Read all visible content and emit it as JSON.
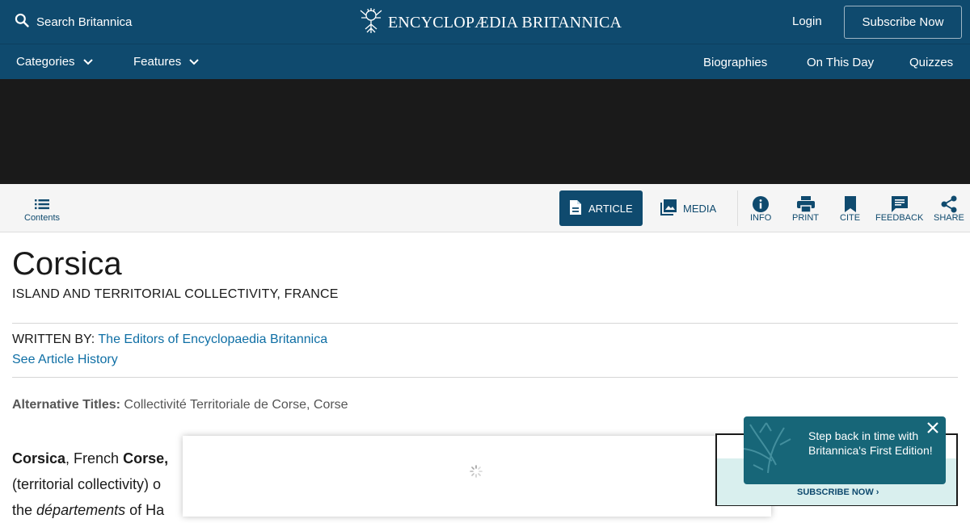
{
  "header": {
    "search_label": "Search Britannica",
    "logo_text": "ENCYCLOPÆDIA BRITANNICA",
    "login_label": "Login",
    "subscribe_label": "Subscribe Now"
  },
  "nav": {
    "left": [
      {
        "label": "Categories",
        "icon": "chevron-down-icon"
      },
      {
        "label": "Features",
        "icon": "chevron-down-icon"
      }
    ],
    "right": [
      "Biographies",
      "On This Day",
      "Quizzes"
    ]
  },
  "toolbar": {
    "contents_label": "Contents",
    "tabs": [
      {
        "label": "ARTICLE",
        "icon": "document-icon",
        "active": true
      },
      {
        "label": "MEDIA",
        "icon": "image-icon",
        "active": false
      }
    ],
    "actions": [
      {
        "label": "INFO",
        "icon": "info-icon"
      },
      {
        "label": "PRINT",
        "icon": "print-icon"
      },
      {
        "label": "CITE",
        "icon": "bookmark-icon"
      },
      {
        "label": "FEEDBACK",
        "icon": "feedback-icon"
      },
      {
        "label": "SHARE",
        "icon": "share-icon"
      }
    ]
  },
  "article": {
    "title": "Corsica",
    "subtitle": "ISLAND AND TERRITORIAL COLLECTIVITY, FRANCE",
    "written_by_label": "WRITTEN BY:",
    "author": "The Editors of Encyclopaedia Britannica",
    "history_link": "See Article History",
    "alt_titles_label": "Alternative Titles:",
    "alt_titles_value": "Collectivité Territoriale de Corse, Corse",
    "body_line1_bold": "Corsica",
    "body_line1_rest": ", French ",
    "body_line1_bold2": "Corse,",
    "body_line2": "(territorial collectivity) o",
    "body_line3_pre": "the ",
    "body_line3_italic": "départements",
    "body_line3_post": " of Ha"
  },
  "ad": {
    "subscribe_label": "SUBSCRIBE NOW ›"
  },
  "toast": {
    "message": "Step back in time with Britannica's First Edition!"
  },
  "colors": {
    "brand": "#0f4a6e",
    "link": "#0f6fa5",
    "toast": "#176678",
    "dark_band": "#1a1a1a"
  }
}
